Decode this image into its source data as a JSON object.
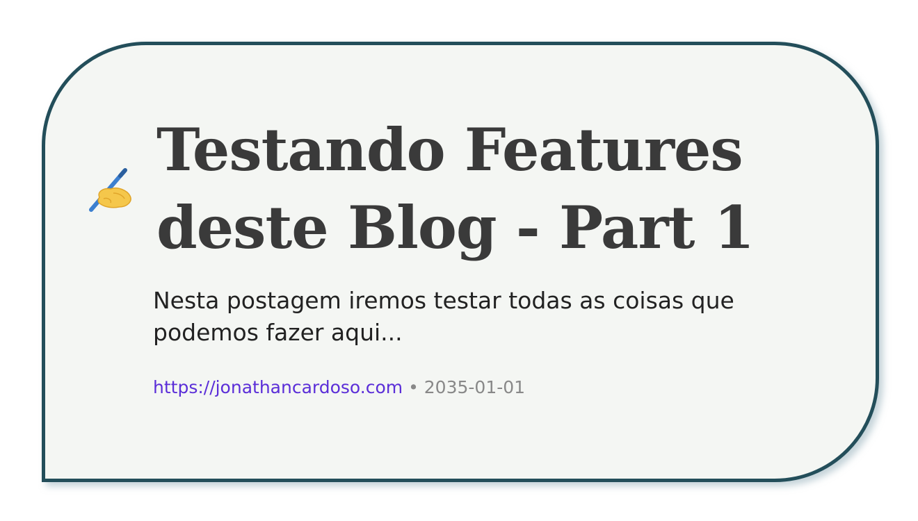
{
  "card": {
    "icon": "writing-hand-icon",
    "title": "Testando Features deste Blog - Part 1",
    "description": "Nesta postagem iremos testar todas as coisas que podemos fazer aqui...",
    "url": "https://jonathancardoso.com",
    "separator": "•",
    "date": "2035-01-01"
  },
  "colors": {
    "card_background": "#f4f6f3",
    "card_border": "#234e5a",
    "title": "#3a3a3a",
    "link": "#5b2ed8",
    "muted": "#888888"
  }
}
